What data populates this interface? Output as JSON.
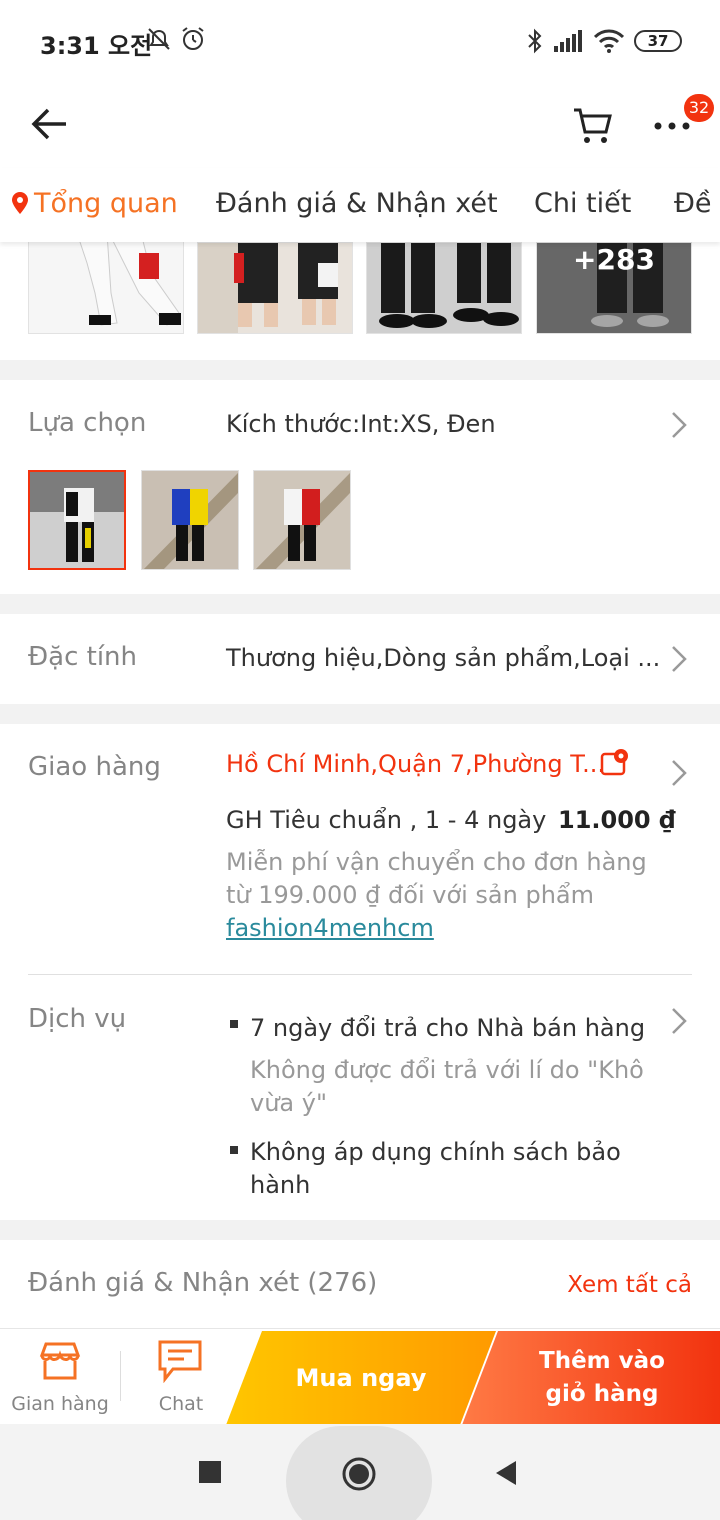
{
  "status_bar": {
    "time": "3:31 오전",
    "battery": "37"
  },
  "header": {
    "cart_badge": "32"
  },
  "tabs": [
    {
      "label": "Tổng quan"
    },
    {
      "label": "Đánh giá & Nhận xét"
    },
    {
      "label": "Chi tiết"
    },
    {
      "label": "Đề x"
    }
  ],
  "gallery": {
    "more_count": "+283"
  },
  "options": {
    "label": "Lựa chọn",
    "value": "Kích thước:Int:XS, Đen"
  },
  "attributes": {
    "label": "Đặc tính",
    "value": "Thương hiệu,Dòng sản phẩm,Loại ..."
  },
  "delivery": {
    "label": "Giao hàng",
    "location": "Hồ Chí Minh,Quận 7,Phường T...",
    "method": "GH Tiêu chuẩn , 1 - 4 ngày",
    "price": "11.000 ₫",
    "free_ship_line1": "Miễn phí vận chuyển cho đơn hàng",
    "free_ship_line2": "từ 199.000 ₫ đối với sản phẩm",
    "shop_link": "fashion4menhcm"
  },
  "services": {
    "label": "Dịch vụ",
    "item1_title": "7 ngày đổi trả cho Nhà bán hàng",
    "item1_note_line1": "Không được đổi trả với lí do \"Không",
    "item1_note_line2": "vừa ý\"",
    "item2_line1": "Không áp dụng chính sách bảo",
    "item2_line2": "hành"
  },
  "reviews": {
    "title": "Đánh giá & Nhận xét (276)",
    "see_all": "Xem tất cả"
  },
  "bottom_bar": {
    "store_label": "Gian hàng",
    "chat_label": "Chat",
    "buy_now": "Mua ngay",
    "add_to_cart_line1": "Thêm vào",
    "add_to_cart_line2": "giỏ hàng"
  },
  "colors": {
    "accent_orange": "#f57224",
    "accent_red": "#f2330f",
    "link_teal": "#2a8a9c"
  }
}
